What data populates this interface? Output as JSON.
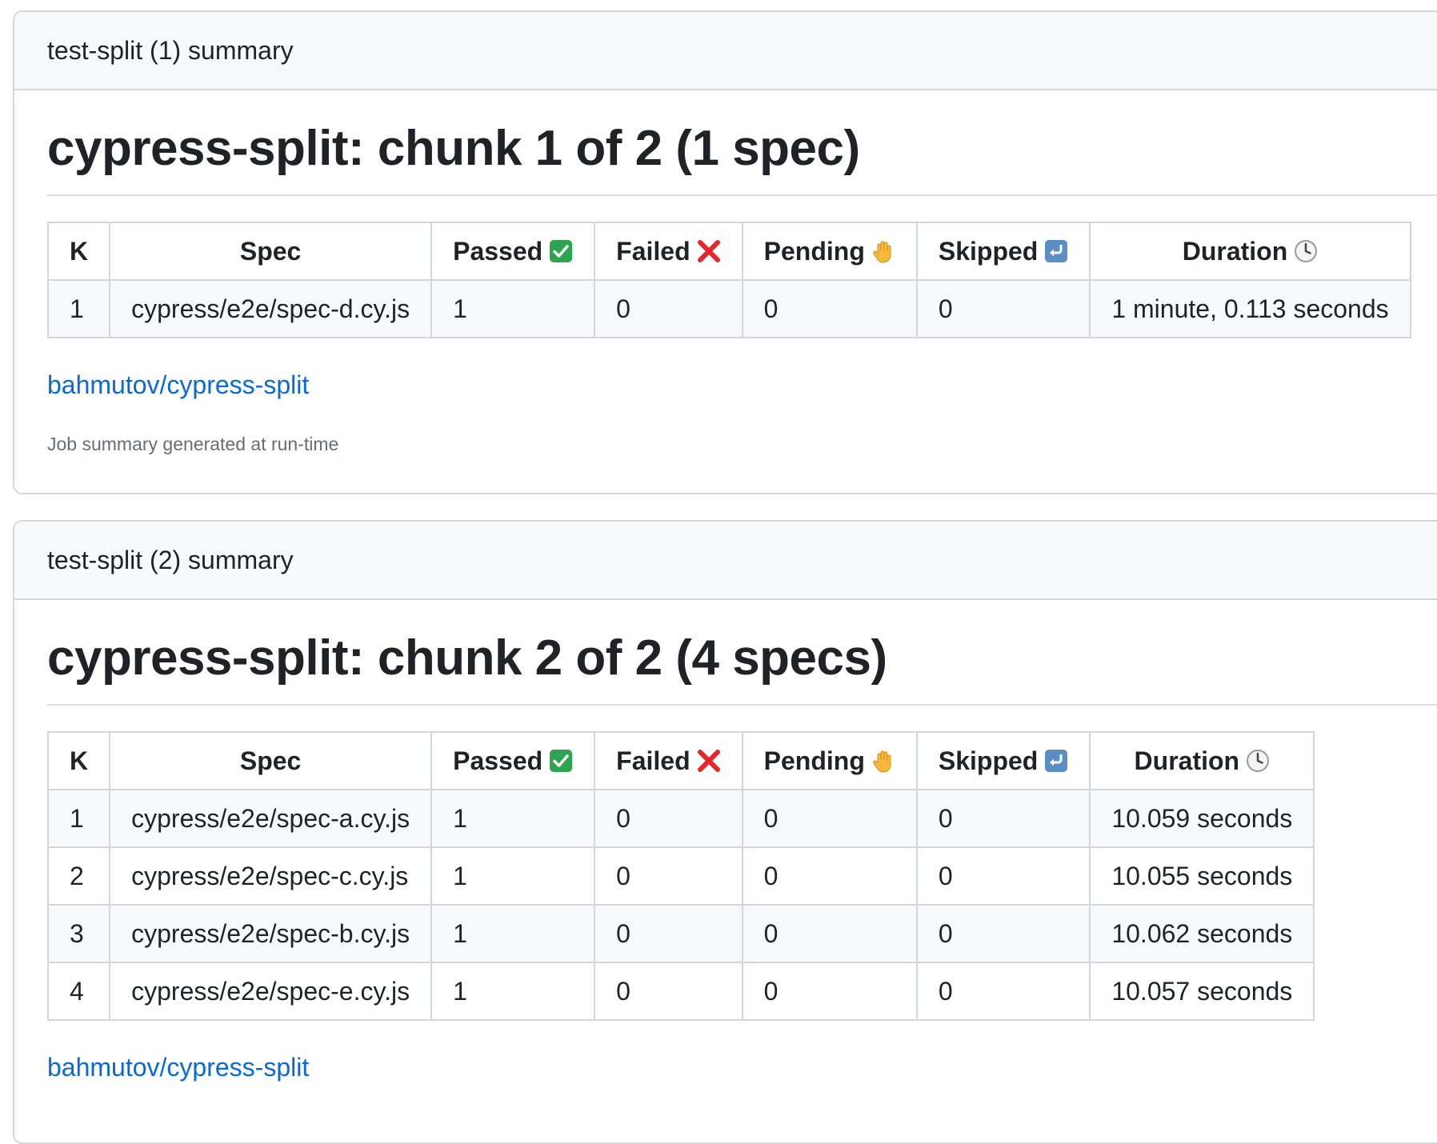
{
  "colors": {
    "link": "#0969da",
    "border": "#d0d7de",
    "header_bg": "#f6f8fa",
    "passed_icon": "#2da44e",
    "failed_icon": "#e5262b",
    "skipped_icon": "#5b8ec4"
  },
  "columns": {
    "k": "K",
    "spec": "Spec",
    "passed": "Passed",
    "failed": "Failed",
    "pending": "Pending",
    "skipped": "Skipped",
    "duration": "Duration"
  },
  "icons": {
    "passed": "check-mark-button-icon",
    "failed": "cross-mark-icon",
    "pending": "raised-hand-icon",
    "skipped": "return-arrow-icon",
    "duration": "clock-icon"
  },
  "summaries": [
    {
      "header": "test-split (1) summary",
      "title": "cypress-split: chunk 1 of 2 (1 spec)",
      "rows": [
        {
          "k": "1",
          "spec": "cypress/e2e/spec-d.cy.js",
          "passed": "1",
          "failed": "0",
          "pending": "0",
          "skipped": "0",
          "duration": "1 minute, 0.113 seconds"
        }
      ],
      "link": "bahmutov/cypress-split",
      "footnote": "Job summary generated at run-time"
    },
    {
      "header": "test-split (2) summary",
      "title": "cypress-split: chunk 2 of 2 (4 specs)",
      "rows": [
        {
          "k": "1",
          "spec": "cypress/e2e/spec-a.cy.js",
          "passed": "1",
          "failed": "0",
          "pending": "0",
          "skipped": "0",
          "duration": "10.059 seconds"
        },
        {
          "k": "2",
          "spec": "cypress/e2e/spec-c.cy.js",
          "passed": "1",
          "failed": "0",
          "pending": "0",
          "skipped": "0",
          "duration": "10.055 seconds"
        },
        {
          "k": "3",
          "spec": "cypress/e2e/spec-b.cy.js",
          "passed": "1",
          "failed": "0",
          "pending": "0",
          "skipped": "0",
          "duration": "10.062 seconds"
        },
        {
          "k": "4",
          "spec": "cypress/e2e/spec-e.cy.js",
          "passed": "1",
          "failed": "0",
          "pending": "0",
          "skipped": "0",
          "duration": "10.057 seconds"
        }
      ],
      "link": "bahmutov/cypress-split"
    }
  ]
}
